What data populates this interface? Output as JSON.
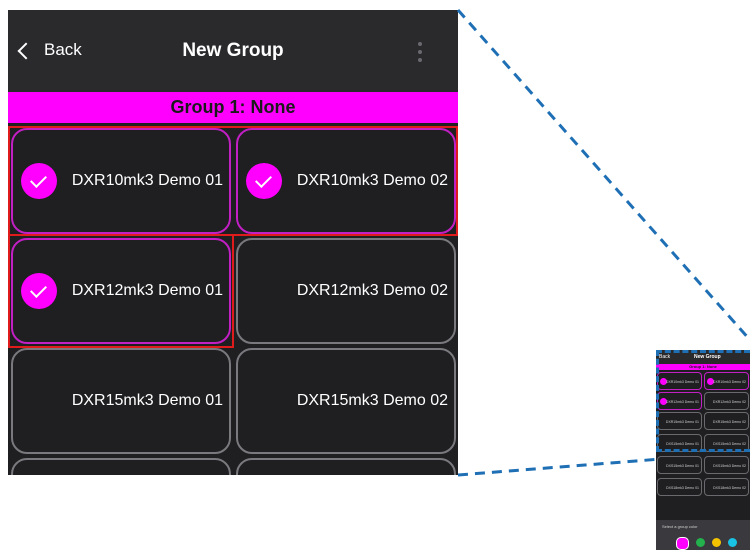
{
  "header": {
    "back_label": "Back",
    "title": "New Group"
  },
  "group_bar": {
    "text": "Group 1: None"
  },
  "devices": [
    {
      "label": "DXR10mk3 Demo 01",
      "selected": true
    },
    {
      "label": "DXR10mk3 Demo 02",
      "selected": true
    },
    {
      "label": "DXR12mk3 Demo 01",
      "selected": true
    },
    {
      "label": "DXR12mk3 Demo 02",
      "selected": false
    },
    {
      "label": "DXR15mk3 Demo 01",
      "selected": false
    },
    {
      "label": "DXR15mk3 Demo 02",
      "selected": false
    }
  ],
  "thumbnail": {
    "back_label": "Back",
    "title": "New Group",
    "group_text": "Group 1: None",
    "devices": [
      "DXR10mk3 Demo 01",
      "DXR10mk3 Demo 02",
      "DXR12mk3 Demo 01",
      "DXR12mk3 Demo 02",
      "DXR15mk3 Demo 01",
      "DXR15mk3 Demo 02",
      "DXS15mk3 Demo 01",
      "DXS15mk3 Demo 02",
      "DXS15mk3 Demo 01",
      "DXS15mk3 Demo 02",
      "DXS18mk3 Demo 01",
      "DXS18mk3 Demo 02"
    ],
    "footer_prompt": "Select a group color",
    "color_dots": [
      "#ff00ff",
      "#22b14c",
      "#f5c400",
      "#19c3e6"
    ]
  },
  "colors": {
    "accent": "#ff00ff",
    "highlight": "#e01b1b",
    "callout_line": "#1f6fb5"
  }
}
